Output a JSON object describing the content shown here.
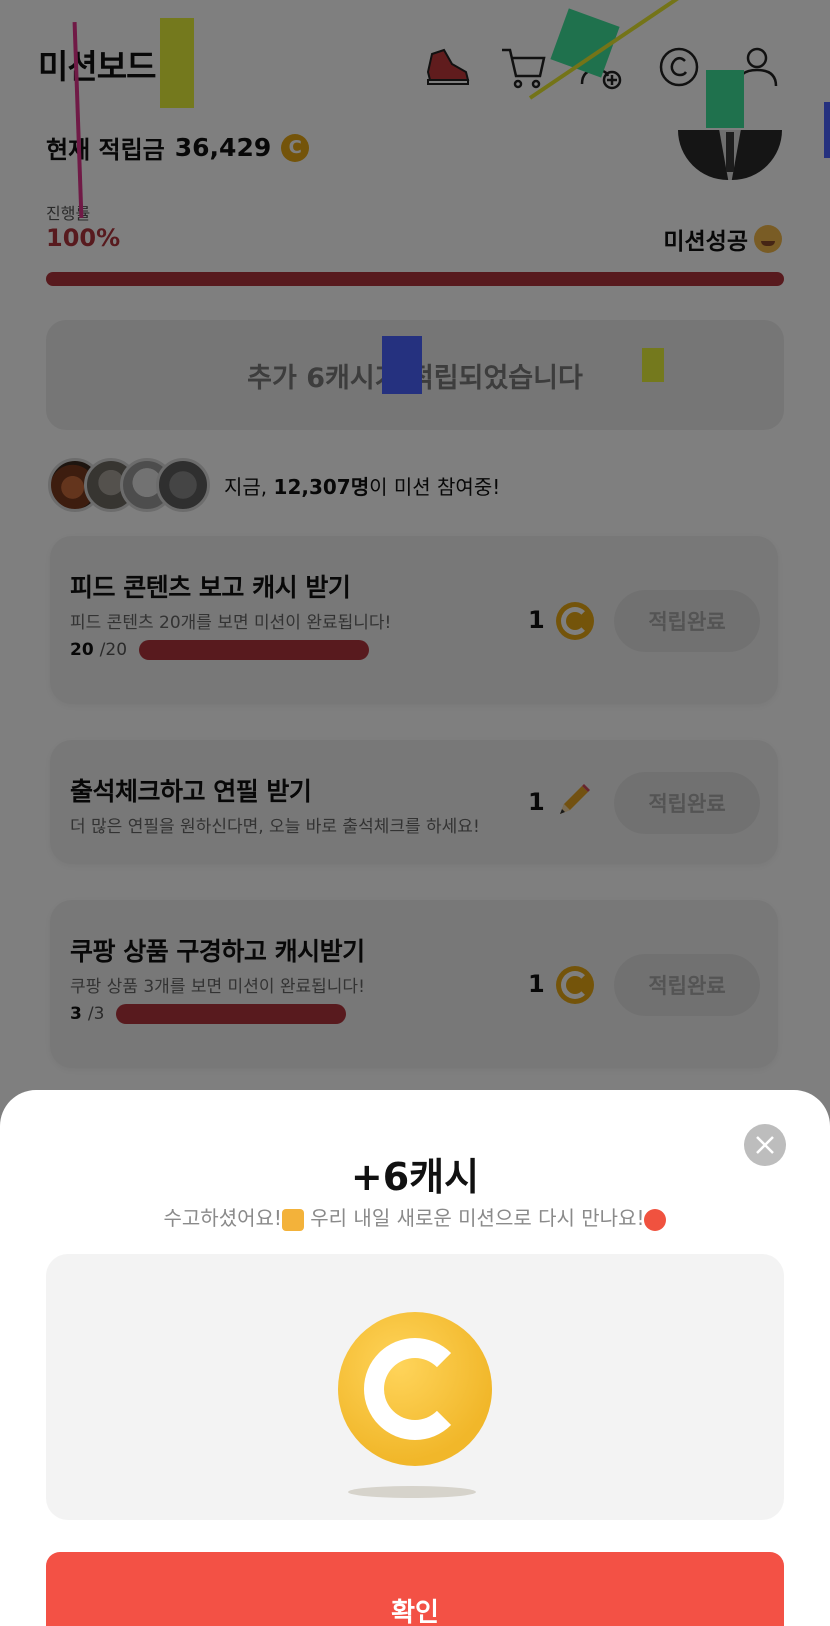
{
  "header": {
    "title": "미션보드",
    "icons": [
      "shoe-icon",
      "cart-icon",
      "add-friend-icon",
      "copyright-coin-icon",
      "profile-icon"
    ]
  },
  "balance": {
    "label": "현재 적립금",
    "value": "36,429",
    "coin_symbol": "C"
  },
  "progress": {
    "label": "진행률",
    "value": "100%",
    "percent": 100,
    "status": "미션성공"
  },
  "banner": {
    "text": "추가 6캐시가 적립되었습니다"
  },
  "participants": {
    "prefix": "지금,",
    "count": "12,307명",
    "suffix": "이 미션 참여중!"
  },
  "missions": [
    {
      "title": "피드 콘텐츠 보고 캐시 받기",
      "subtitle": "피드 콘텐츠 20개를 보면 미션이 완료됩니다!",
      "done": "20",
      "total": "/20",
      "fraction": 1.0,
      "reward": "1",
      "reward_icon": "coin-icon",
      "button": "적립완료"
    },
    {
      "title": "출석체크하고 연필 받기",
      "subtitle": "더 많은 연필을 원하신다면, 오늘 바로 출석체크를 하세요!",
      "reward": "1",
      "reward_icon": "pencil-icon",
      "button": "적립완료"
    },
    {
      "title": "쿠팡 상품 구경하고 캐시받기",
      "subtitle": "쿠팡 상품 3개를 보면 미션이 완료됩니다!",
      "done": "3",
      "total": "/3",
      "fraction": 1.0,
      "reward": "1",
      "reward_icon": "coin-icon",
      "button": "적립완료"
    }
  ],
  "sheet": {
    "title": "+6캐시",
    "subtitle_a": "수고하셨어요!",
    "subtitle_b": " 우리 내일 새로운 미션으로 다시 만나요!",
    "confirm": "확인"
  },
  "colors": {
    "accent_red": "#b0353c",
    "confirm_red": "#f35145",
    "coin_gold": "#e8a915"
  }
}
